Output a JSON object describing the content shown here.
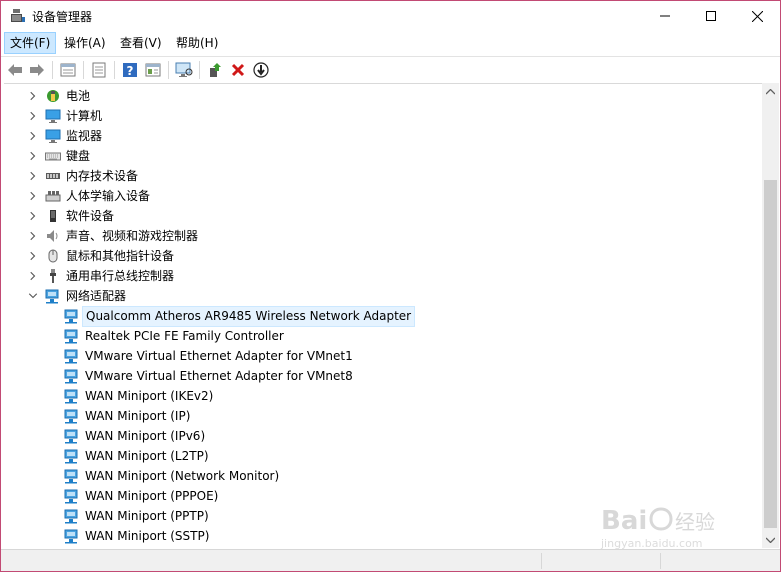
{
  "window": {
    "title": "设备管理器",
    "border_color": "#c24a74"
  },
  "menu": {
    "items": [
      {
        "label": "文件(F)"
      },
      {
        "label": "操作(A)"
      },
      {
        "label": "查看(V)"
      },
      {
        "label": "帮助(H)"
      }
    ]
  },
  "toolbar": {
    "buttons": [
      "back-icon",
      "forward-icon",
      "properties-icon",
      "update-driver-icon",
      "help-icon",
      "view-icon",
      "monitor-scan-icon",
      "enable-device-icon",
      "uninstall-icon",
      "disable-icon"
    ]
  },
  "tree": {
    "categories": [
      {
        "label": "电池",
        "icon": "battery-icon",
        "expanded": false
      },
      {
        "label": "计算机",
        "icon": "computer-icon",
        "expanded": false
      },
      {
        "label": "监视器",
        "icon": "monitor-icon",
        "expanded": false
      },
      {
        "label": "键盘",
        "icon": "keyboard-icon",
        "expanded": false
      },
      {
        "label": "内存技术设备",
        "icon": "memory-icon",
        "expanded": false
      },
      {
        "label": "人体学输入设备",
        "icon": "hid-icon",
        "expanded": false
      },
      {
        "label": "软件设备",
        "icon": "software-device-icon",
        "expanded": false
      },
      {
        "label": "声音、视频和游戏控制器",
        "icon": "speaker-icon",
        "expanded": false
      },
      {
        "label": "鼠标和其他指针设备",
        "icon": "mouse-icon",
        "expanded": false
      },
      {
        "label": "通用串行总线控制器",
        "icon": "usb-icon",
        "expanded": false
      },
      {
        "label": "网络适配器",
        "icon": "network-adapter-icon",
        "expanded": true
      }
    ],
    "network_adapters": [
      {
        "label": "Qualcomm Atheros AR9485 Wireless Network Adapter",
        "selected": true
      },
      {
        "label": "Realtek PCIe FE Family Controller"
      },
      {
        "label": "VMware Virtual Ethernet Adapter for VMnet1"
      },
      {
        "label": "VMware Virtual Ethernet Adapter for VMnet8"
      },
      {
        "label": "WAN Miniport (IKEv2)"
      },
      {
        "label": "WAN Miniport (IP)"
      },
      {
        "label": "WAN Miniport (IPv6)"
      },
      {
        "label": "WAN Miniport (L2TP)"
      },
      {
        "label": "WAN Miniport (Network Monitor)"
      },
      {
        "label": "WAN Miniport (PPPOE)"
      },
      {
        "label": "WAN Miniport (PPTP)"
      },
      {
        "label": "WAN Miniport (SSTP)"
      }
    ]
  },
  "colors": {
    "selection": "#e5f3ff",
    "menu_active": "#cce8ff",
    "network_icon": "#1e7fc8"
  }
}
